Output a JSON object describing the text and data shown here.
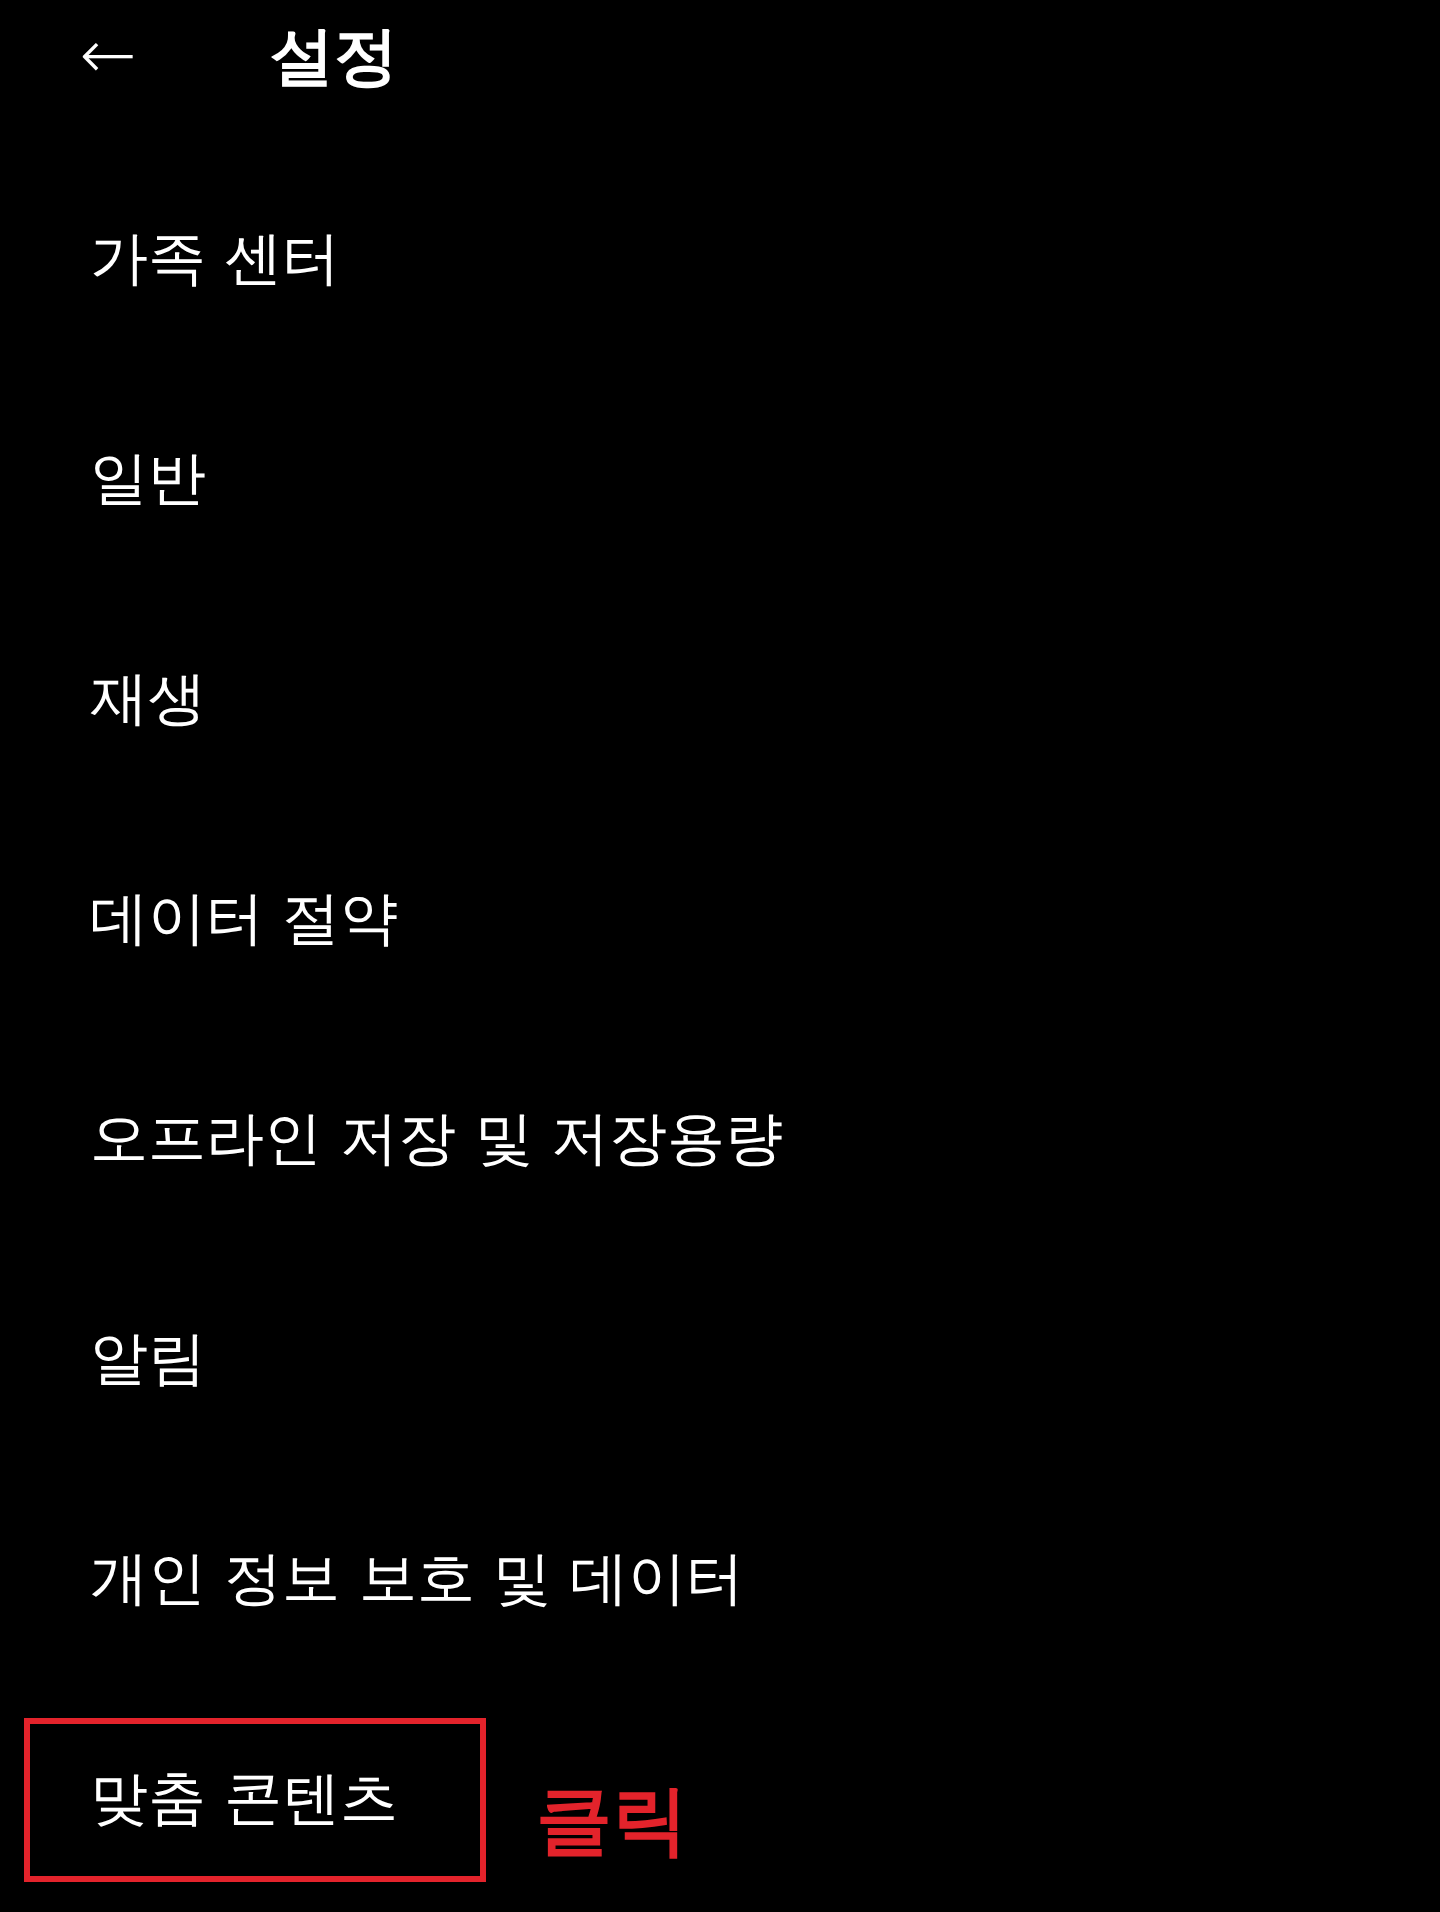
{
  "header": {
    "back": "←",
    "title": "설정"
  },
  "items": [
    {
      "label": "가족 센터",
      "highlighted": false
    },
    {
      "label": "일반",
      "highlighted": false
    },
    {
      "label": "재생",
      "highlighted": false
    },
    {
      "label": "데이터 절약",
      "highlighted": false
    },
    {
      "label": "오프라인 저장 및 저장용량",
      "highlighted": false
    },
    {
      "label": "알림",
      "highlighted": false
    },
    {
      "label": "개인 정보 보호 및 데이터",
      "highlighted": false
    },
    {
      "label": "맞춤 콘텐츠",
      "highlighted": true,
      "note": "클릭"
    }
  ]
}
